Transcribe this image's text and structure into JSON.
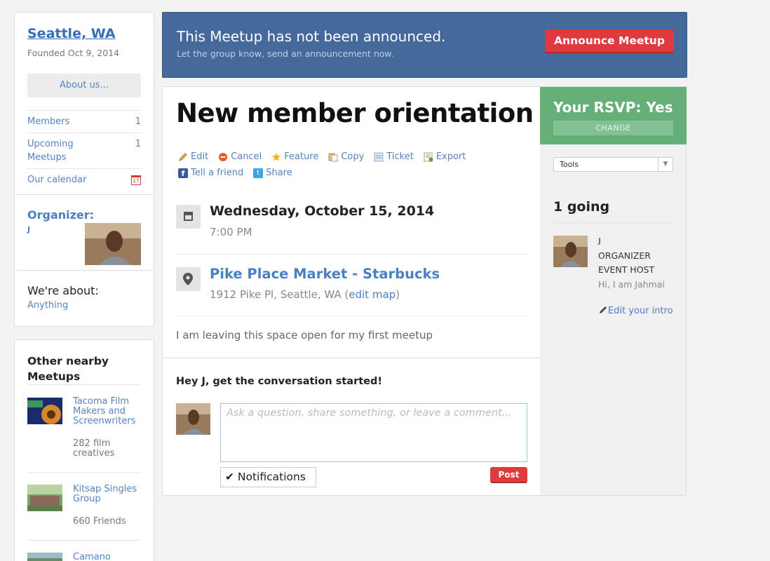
{
  "group": {
    "name": "Seattle, WA",
    "founded": "Founded Oct 9, 2014",
    "about_button": "About us...",
    "links": [
      {
        "label": "Members",
        "count": "1"
      },
      {
        "label": "Upcoming Meetups",
        "count": "1"
      },
      {
        "label": "Our calendar",
        "icon": "calendar-icon"
      }
    ],
    "calendar_number": "17",
    "organizer_label": "Organizer:",
    "organizer_name": "J",
    "about_label": "We're about:",
    "about_value": "Anything"
  },
  "nearby": {
    "title": "Other nearby Meetups",
    "items": [
      {
        "name": "Tacoma Film Makers and Screenwriters",
        "count": "282 film creatives"
      },
      {
        "name": "Kitsap Singles Group",
        "count": "660 Friends"
      },
      {
        "name": "Camano",
        "count": ""
      }
    ]
  },
  "banner": {
    "title": "This Meetup has not been announced.",
    "subtitle": "Let the group know, send an announcement now.",
    "button": "Announce Meetup"
  },
  "event": {
    "title": "New member orientation",
    "actions_row1": [
      "Edit",
      "Cancel",
      "Feature",
      "Copy",
      "Ticket",
      "Export"
    ],
    "actions_row2": [
      "Tell a friend",
      "Share"
    ],
    "date": "Wednesday, October 15, 2014",
    "time": "7:00 PM",
    "venue": "Pike Place Market - Starbucks",
    "address": "1912 Pike Pl, Seattle, WA (",
    "edit_map": "edit map",
    "address_end": ")",
    "description": "I am leaving this space open for my first meetup",
    "conversation_prompt": "Hey J, get the conversation started!",
    "comment_placeholder": "Ask a question, share something, or leave a comment...",
    "notifications_label": "Notifications",
    "post_button": "Post"
  },
  "rsvp": {
    "status": "Your RSVP: Yes",
    "change_button": "CHANGE",
    "tools_select": "Tools",
    "going_count": "1 going",
    "attendee": {
      "name": "J",
      "role1": "ORGANIZER",
      "role2": "EVENT HOST",
      "intro": "Hi, I am Jahmai",
      "edit_intro": "Edit your intro"
    }
  },
  "colors": {
    "banner": "#46699b",
    "announce": "#e0393e",
    "rsvp": "#64b078",
    "link": "#4a7fc0"
  }
}
